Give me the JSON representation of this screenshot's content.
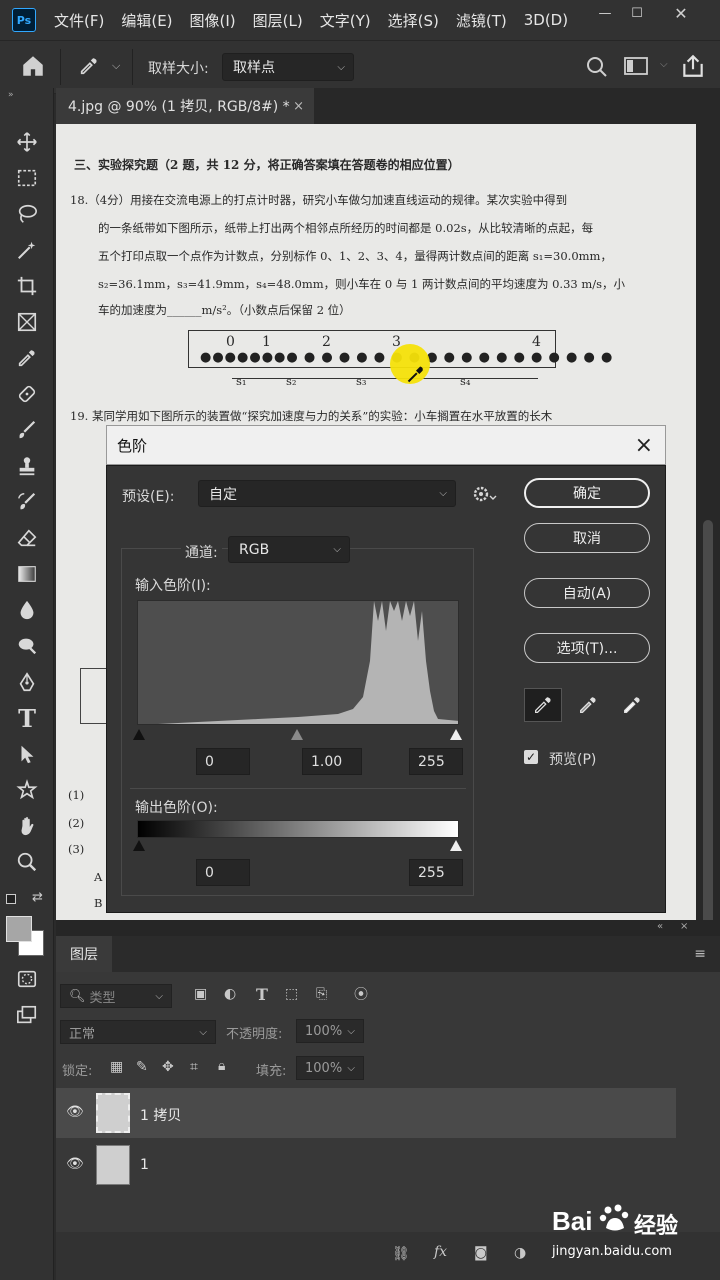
{
  "menubar": {
    "app_icon": "Ps",
    "items": [
      "文件(F)",
      "编辑(E)",
      "图像(I)",
      "图层(L)",
      "文字(Y)",
      "选择(S)",
      "滤镜(T)",
      "3D(D)"
    ]
  },
  "options_bar": {
    "sample_size_label": "取样大小:",
    "sample_size_value": "取样点"
  },
  "document": {
    "tab_title": "4.jpg @ 90% (1 拷贝, RGB/8#) *",
    "close": "×"
  },
  "scan": {
    "section_title": "三、实验探究题（2 题，共 12 分，将正确答案填在答题卷的相应位置）",
    "q18_line1": "18.（4分）用接在交流电源上的打点计时器，研究小车做匀加速直线运动的规律。某次实验中得到",
    "q18_line2": "的一条纸带如下图所示，纸带上打出两个相邻点所经历的时间都是 0.02s，从比较清晰的点起，每",
    "q18_line3": "五个打印点取一个点作为计数点，分别标作 0、1、2、3、4，量得两计数点间的距离 s₁=30.0mm，",
    "q18_line4": "s₂=36.1mm，s₃=41.9mm，s₄=48.0mm，则小车在 0 与 1 两计数点间的平均速度为 0.33 m/s，小",
    "q18_line5": "车的加速度为______m/s²。（小数点后保留 2 位）",
    "tape_labels": [
      "0",
      "1",
      "2",
      "3",
      "4"
    ],
    "tape_segments": [
      "s₁",
      "s₂",
      "s₃",
      "s₄"
    ],
    "q19_line1": "19. 某同学用如下图所示的装置做“探究加速度与力的关系”的实验：小车搁置在水平放置的长木",
    "left_edge_text": [
      "(1)",
      "(2)",
      "(3)",
      "A",
      "B"
    ]
  },
  "levels_dialog": {
    "title": "色阶",
    "preset_label": "预设(E):",
    "preset_value": "自定",
    "channel_label": "通道:",
    "channel_value": "RGB",
    "input_levels_label": "输入色阶(I):",
    "input_black": "0",
    "input_gamma": "1.00",
    "input_white": "255",
    "output_levels_label": "输出色阶(O):",
    "output_black": "0",
    "output_white": "255",
    "buttons": {
      "ok": "确定",
      "cancel": "取消",
      "auto": "自动(A)",
      "options": "选项(T)..."
    },
    "preview_label": "预览(P)",
    "preview_checked": true,
    "close": "×"
  },
  "layers_panel": {
    "tab": "图层",
    "filter_kind": "类型",
    "blend_mode": "正常",
    "opacity_label": "不透明度:",
    "opacity_value": "100%",
    "lock_label": "锁定:",
    "fill_label": "填充:",
    "fill_value": "100%",
    "layers": [
      {
        "name": "1 拷贝",
        "selected": true
      },
      {
        "name": "1",
        "selected": false
      }
    ]
  },
  "watermark": {
    "brand": "Bai",
    "brand_suffix": "经验",
    "url": "jingyan.baidu.com"
  },
  "colors": {
    "menubar_bg": "#323232",
    "panel_bg": "#383838",
    "dialog_bg": "#353535",
    "accent_blue": "#31a8ff",
    "cursor_yellow": "#f5e20a"
  }
}
